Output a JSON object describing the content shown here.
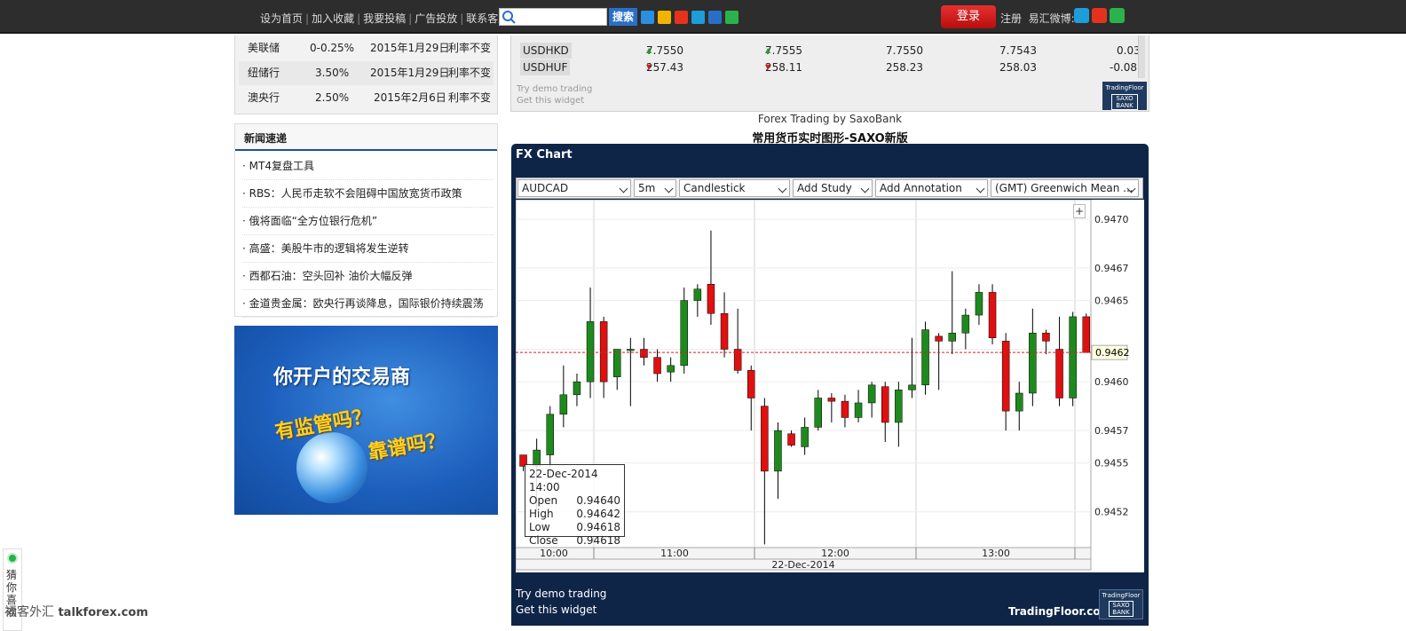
{
  "topbar": {
    "links": [
      "设为首页",
      "加入收藏",
      "我要投稿",
      "广告投放",
      "联系客服"
    ],
    "search_placeholder": "",
    "search_btn": "搜索",
    "login": "登录",
    "register": "注册",
    "weibo_label": "易汇微博:"
  },
  "rates": [
    {
      "bank": "美联储",
      "rate": "0-0.25%",
      "date": "2015年1月29日",
      "status": "利率不变"
    },
    {
      "bank": "纽储行",
      "rate": "3.50%",
      "date": "2015年1月29日",
      "status": "利率不变"
    },
    {
      "bank": "澳央行",
      "rate": "2.50%",
      "date": "2015年2月6日",
      "status": "利率不变"
    }
  ],
  "news": {
    "title": "新闻速递",
    "items": [
      "MT4复盘工具",
      "RBS：人民币走软不会阻碍中国放宽货币政策",
      "俄将面临“全方位银行危机”",
      "高盛：美股牛市的逻辑将发生逆转",
      "西都石油：空头回补 油价大幅反弹",
      "金道贵金属：欧央行再谈降息，国际银价持续震荡"
    ]
  },
  "ad": {
    "title": "你开户的交易商",
    "line1": "有监管吗？",
    "line2": "靠谱吗？"
  },
  "quotes": {
    "rows": [
      {
        "sym": "USDHKD",
        "bid": "7.7550",
        "bid_dir": "up",
        "ask": "7.7555",
        "ask_dir": "up",
        "high": "7.7550",
        "low": "7.7543",
        "chg": "0.03"
      },
      {
        "sym": "USDHUF",
        "bid": "257.43",
        "bid_dir": "down",
        "ask": "258.11",
        "ask_dir": "down",
        "high": "258.23",
        "low": "258.03",
        "chg": "-0.08"
      }
    ],
    "demo": "Try demo trading",
    "widget": "Get this widget",
    "logo_top": "TradingFloor",
    "logo_box": "SAXO BANK"
  },
  "captions": {
    "line1": "Forex Trading by SaxoBank",
    "line2": "常用货币实时图形-SAXO新版"
  },
  "fx": {
    "title": "FX Chart",
    "toolbar": {
      "symbol": "AUDCAD",
      "interval": "5m",
      "type": "Candlestick",
      "study": "Add Study",
      "annotation": "Add Annotation",
      "timezone": "(GMT) Greenwich Mean ..."
    },
    "demo": "Try demo trading",
    "widget": "Get this widget",
    "brand": "TradingFloor.com",
    "logo_top": "TradingFloor",
    "logo_box": "SAXO BANK"
  },
  "chart_data": {
    "type": "candlestick",
    "symbol": "AUDCAD",
    "date_label": "22-Dec-2014",
    "x_ticks": [
      "10:00",
      "11:00",
      "12:00",
      "13:00"
    ],
    "y_ticks": [
      "0.9470",
      "0.9467",
      "0.9465",
      "0.9462",
      "0.9460",
      "0.9457",
      "0.9455",
      "0.9452"
    ],
    "ylim": [
      0.94498,
      0.94712
    ],
    "last_price": "0.9462",
    "last_price_value": 0.94618,
    "tooltip": {
      "time": "22-Dec-2014 14:00",
      "rows": [
        [
          "Open",
          "0.94640"
        ],
        [
          "High",
          "0.94642"
        ],
        [
          "Low",
          "0.94618"
        ],
        [
          "Close",
          "0.94618"
        ]
      ]
    },
    "colors": {
      "up": "#1e8a1e",
      "down": "#e01010"
    },
    "candles": [
      [
        0.94555,
        0.94555,
        0.94545,
        0.94548
      ],
      [
        0.94548,
        0.94565,
        0.9452,
        0.94558
      ],
      [
        0.94555,
        0.94585,
        0.9454,
        0.9458
      ],
      [
        0.9458,
        0.9461,
        0.94572,
        0.94592
      ],
      [
        0.94592,
        0.94605,
        0.94585,
        0.946
      ],
      [
        0.946,
        0.94658,
        0.9459,
        0.94637
      ],
      [
        0.94637,
        0.9464,
        0.9459,
        0.946
      ],
      [
        0.94603,
        0.9462,
        0.94595,
        0.9462
      ],
      [
        0.9462,
        0.94627,
        0.94585,
        0.9462
      ],
      [
        0.9462,
        0.94627,
        0.9461,
        0.94615
      ],
      [
        0.94615,
        0.9462,
        0.946,
        0.94605
      ],
      [
        0.94606,
        0.94615,
        0.946,
        0.9461
      ],
      [
        0.9461,
        0.94658,
        0.94605,
        0.9465
      ],
      [
        0.9465,
        0.9466,
        0.9464,
        0.94657
      ],
      [
        0.9466,
        0.94693,
        0.94635,
        0.94642
      ],
      [
        0.94642,
        0.94655,
        0.94615,
        0.9462
      ],
      [
        0.9462,
        0.94645,
        0.94605,
        0.94607
      ],
      [
        0.94607,
        0.9461,
        0.9457,
        0.9459
      ],
      [
        0.94585,
        0.9459,
        0.945,
        0.94545
      ],
      [
        0.94545,
        0.94575,
        0.94528,
        0.9457
      ],
      [
        0.94568,
        0.9457,
        0.9456,
        0.94561
      ],
      [
        0.9456,
        0.94578,
        0.94555,
        0.94572
      ],
      [
        0.94572,
        0.94595,
        0.9457,
        0.9459
      ],
      [
        0.9459,
        0.94593,
        0.94575,
        0.94588
      ],
      [
        0.94588,
        0.94592,
        0.94572,
        0.94578
      ],
      [
        0.94578,
        0.94595,
        0.94575,
        0.94587
      ],
      [
        0.94587,
        0.946,
        0.94578,
        0.94598
      ],
      [
        0.94597,
        0.946,
        0.94563,
        0.94575
      ],
      [
        0.94575,
        0.946,
        0.9456,
        0.94595
      ],
      [
        0.94595,
        0.94627,
        0.9459,
        0.94598
      ],
      [
        0.94598,
        0.94637,
        0.94592,
        0.94632
      ],
      [
        0.94628,
        0.9463,
        0.94595,
        0.94625
      ],
      [
        0.94625,
        0.94668,
        0.94617,
        0.9463
      ],
      [
        0.9463,
        0.94645,
        0.9462,
        0.94641
      ],
      [
        0.94641,
        0.9466,
        0.94635,
        0.94655
      ],
      [
        0.94655,
        0.9466,
        0.94623,
        0.94627
      ],
      [
        0.94625,
        0.9463,
        0.9457,
        0.94582
      ],
      [
        0.94582,
        0.946,
        0.9457,
        0.94593
      ],
      [
        0.94593,
        0.94645,
        0.94585,
        0.9463
      ],
      [
        0.9463,
        0.94632,
        0.94617,
        0.94625
      ],
      [
        0.9462,
        0.9464,
        0.94585,
        0.9459
      ],
      [
        0.9459,
        0.94643,
        0.94585,
        0.9464
      ],
      [
        0.9464,
        0.94642,
        0.94618,
        0.94618
      ]
    ]
  }
}
